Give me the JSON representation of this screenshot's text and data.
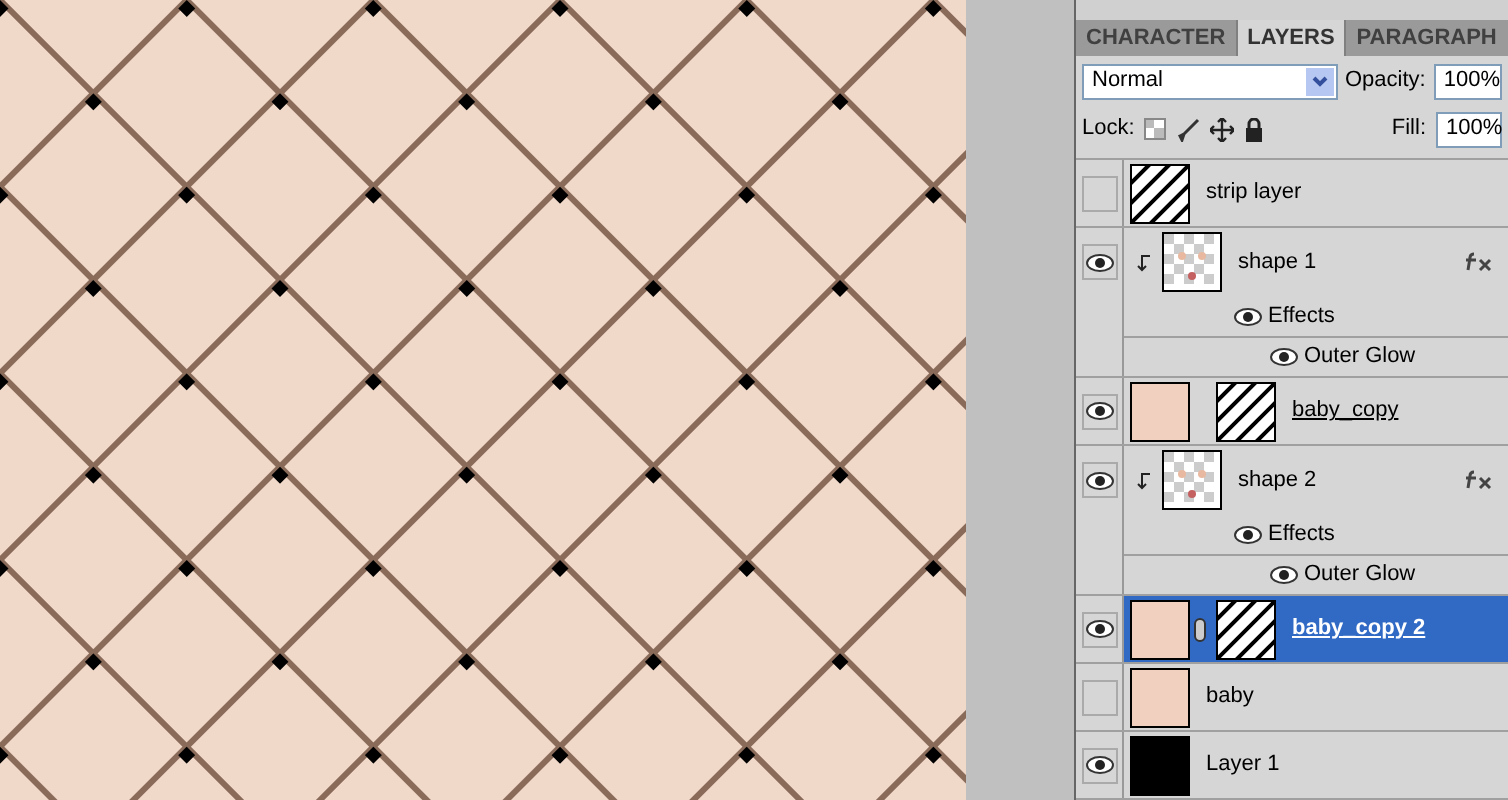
{
  "tabs": [
    {
      "label": "CHARACTER",
      "selected": false
    },
    {
      "label": "LAYERS",
      "selected": true
    },
    {
      "label": "PARAGRAPH",
      "selected": false
    }
  ],
  "blend_mode": "Normal",
  "opacity_label": "Opacity:",
  "opacity": "100%",
  "lock_label": "Lock:",
  "fill_label": "Fill:",
  "fill": "100%",
  "layers": [
    {
      "kind": "stripes",
      "name": "strip layer",
      "visible": false,
      "selected": false,
      "underlined": false,
      "clipped": false,
      "linked": false,
      "fx": false,
      "mask": false
    },
    {
      "kind": "shape",
      "name": "shape 1",
      "visible": true,
      "selected": false,
      "underlined": false,
      "clipped": true,
      "linked": false,
      "fx": true,
      "mask": false,
      "effects": [
        {
          "label": "Effects",
          "visible": true,
          "children": [
            {
              "label": "Outer Glow",
              "visible": true
            }
          ]
        }
      ]
    },
    {
      "kind": "photo",
      "name": "baby_copy",
      "visible": true,
      "selected": false,
      "underlined": true,
      "clipped": false,
      "linked": false,
      "fx": false,
      "mask": true
    },
    {
      "kind": "shape",
      "name": "shape 2",
      "visible": true,
      "selected": false,
      "underlined": false,
      "clipped": true,
      "linked": false,
      "fx": true,
      "mask": false,
      "effects": [
        {
          "label": "Effects",
          "visible": true,
          "children": [
            {
              "label": "Outer Glow",
              "visible": true
            }
          ]
        }
      ]
    },
    {
      "kind": "photo",
      "name": "baby_copy 2",
      "visible": true,
      "selected": true,
      "underlined": true,
      "clipped": false,
      "linked": true,
      "fx": false,
      "mask": true
    },
    {
      "kind": "photo",
      "name": "baby",
      "visible": false,
      "selected": false,
      "underlined": false,
      "clipped": false,
      "linked": false,
      "fx": false,
      "mask": false
    },
    {
      "kind": "solid",
      "name": "Layer 1",
      "visible": true,
      "selected": false,
      "underlined": false,
      "clipped": false,
      "linked": false,
      "fx": false,
      "mask": false
    }
  ]
}
